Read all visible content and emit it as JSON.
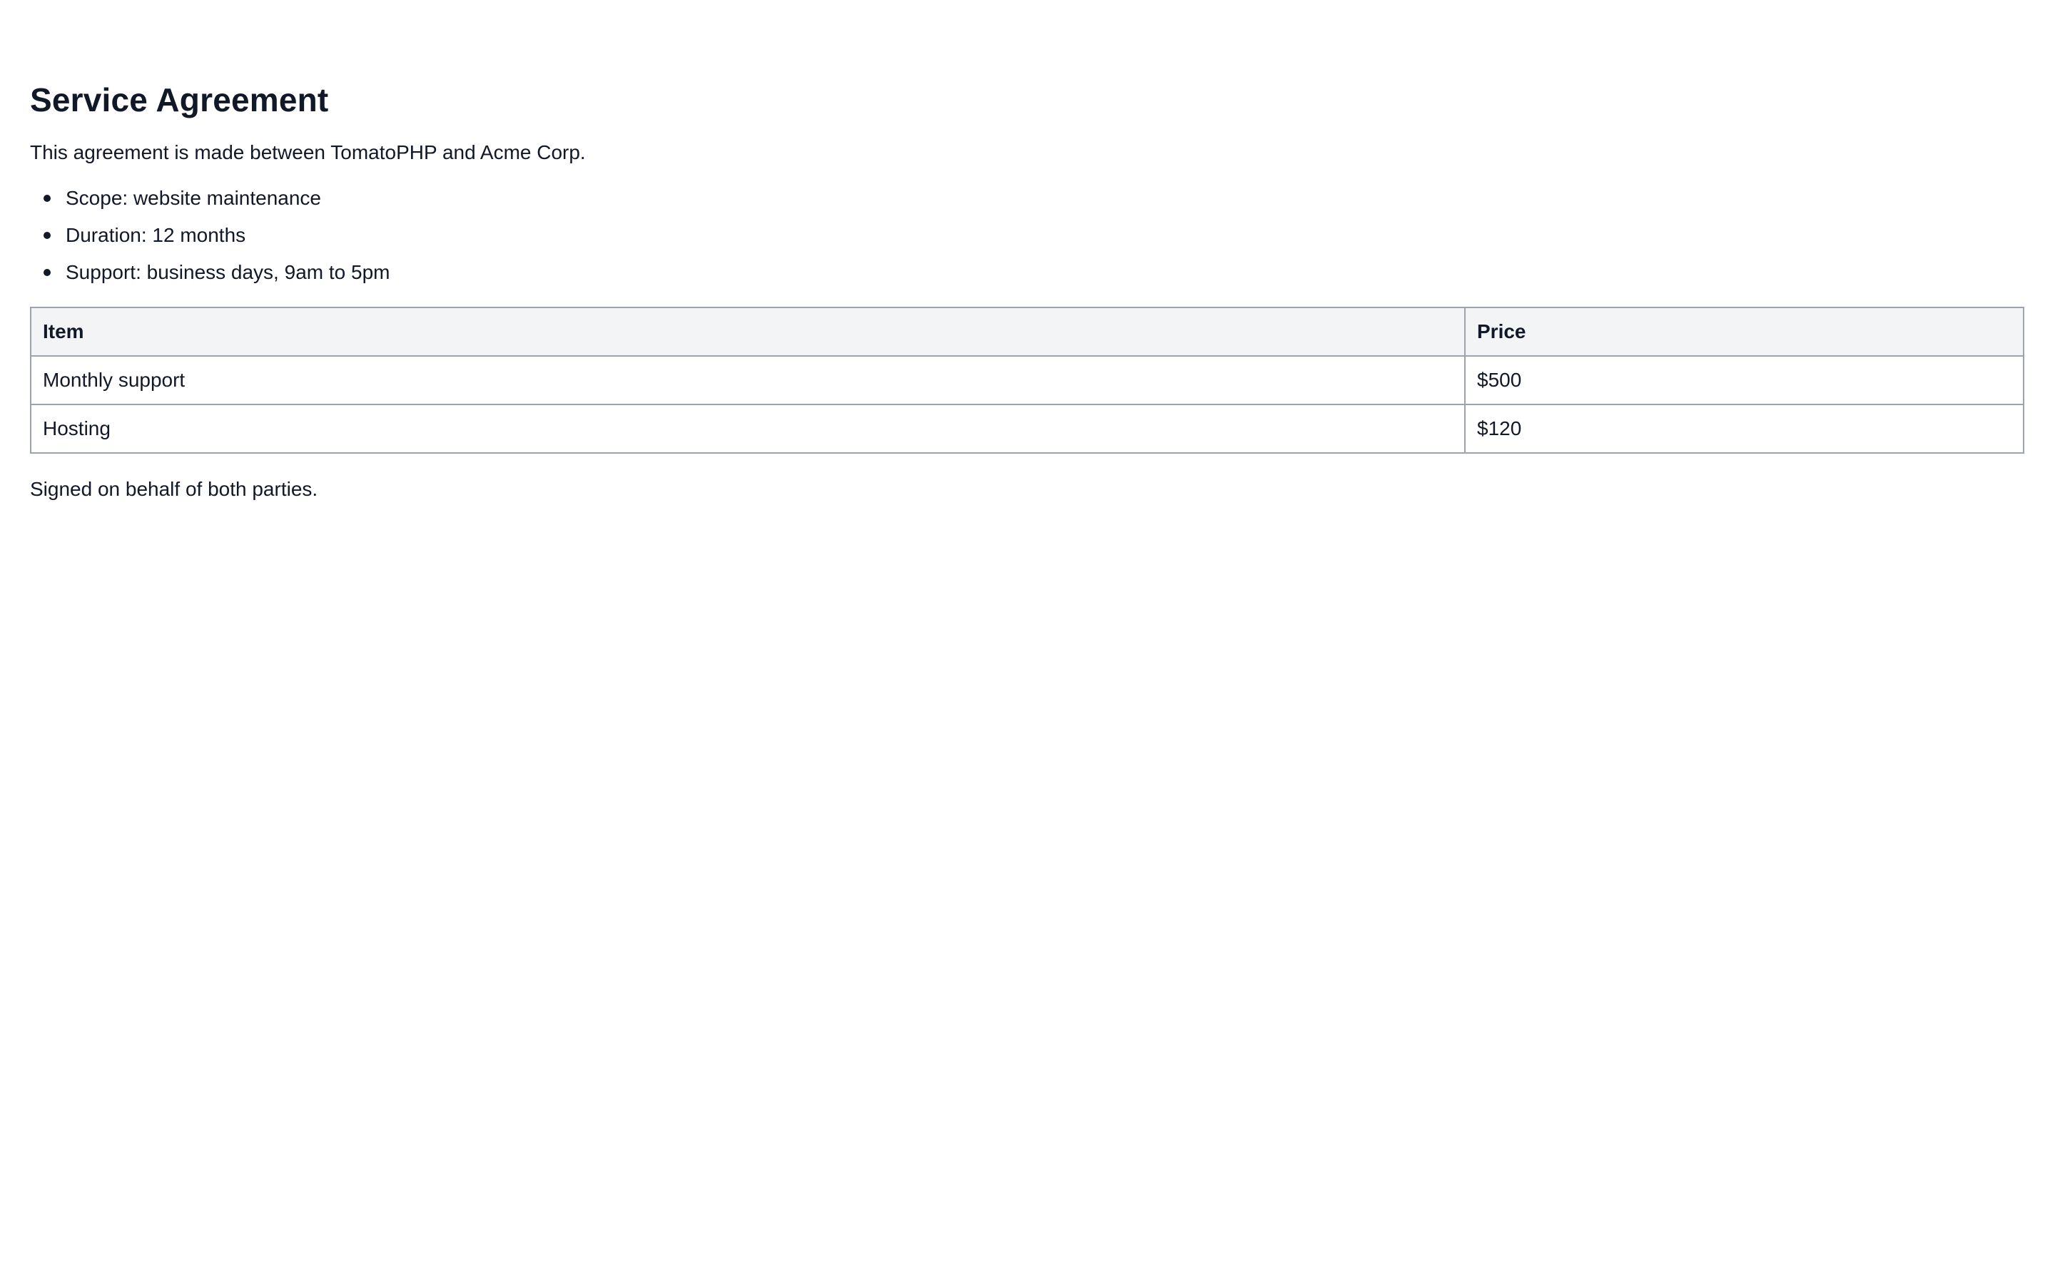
{
  "document": {
    "title": "Service Agreement",
    "intro": "This agreement is made between TomatoPHP and Acme Corp.",
    "terms": [
      "Scope: website maintenance",
      "Duration: 12 months",
      "Support: business days, 9am to 5pm"
    ],
    "table": {
      "headers": [
        "Item",
        "Price"
      ],
      "rows": [
        [
          "Monthly support",
          "$500"
        ],
        [
          "Hosting",
          "$120"
        ]
      ]
    },
    "closing": "Signed on behalf of both parties."
  },
  "colors": {
    "text": "#111827",
    "table_header_bg": "#f3f4f6",
    "table_border": "#9ca3af",
    "background": "#ffffff"
  }
}
